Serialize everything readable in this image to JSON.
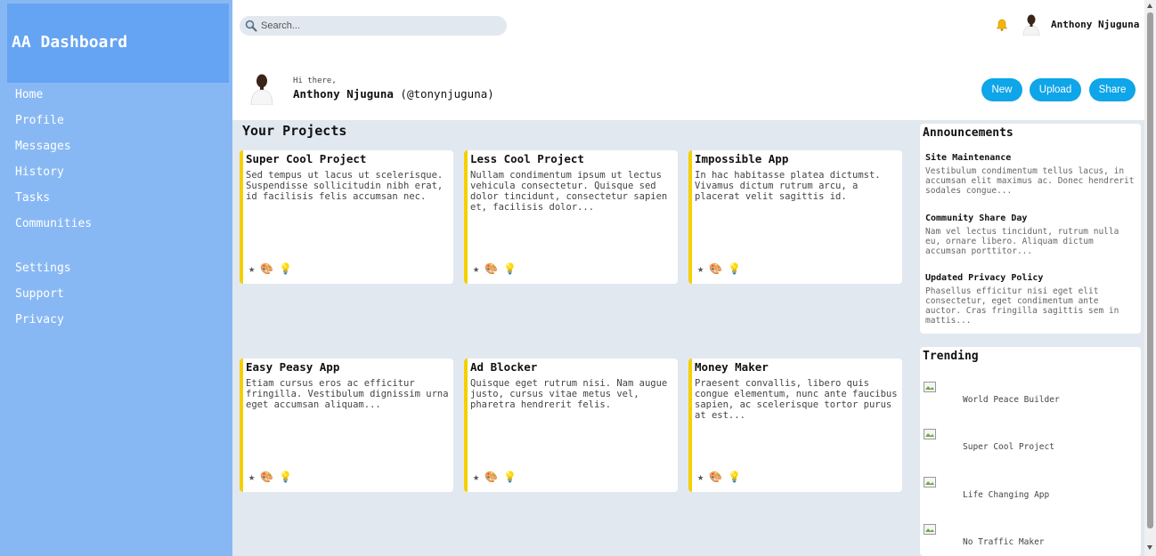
{
  "brand": "AA Dashboard",
  "sidebar": {
    "primary": [
      {
        "label": "Home"
      },
      {
        "label": "Profile"
      },
      {
        "label": "Messages"
      },
      {
        "label": "History"
      },
      {
        "label": "Tasks"
      },
      {
        "label": "Communities"
      }
    ],
    "secondary": [
      {
        "label": "Settings"
      },
      {
        "label": "Support"
      },
      {
        "label": "Privacy"
      }
    ]
  },
  "search": {
    "placeholder": "Search...",
    "icon": "search-icon"
  },
  "header": {
    "user_name": "Anthony Njuguna",
    "greeting": "Hi there,",
    "full_name": "Anthony Njuguna",
    "handle": "(@tonynjuguna)",
    "buttons": {
      "new": "New",
      "upload": "Upload",
      "share": "Share"
    }
  },
  "projects": {
    "title": "Your Projects",
    "items": [
      {
        "title": "Super Cool Project",
        "text": "Sed tempus ut lacus ut scelerisque. Suspendisse sollicitudin nibh erat, id facilisis felis accumsan nec."
      },
      {
        "title": "Less Cool Project",
        "text": "Nullam condimentum ipsum ut lectus vehicula consectetur. Quisque sed dolor tincidunt, consectetur sapien et, facilisis dolor..."
      },
      {
        "title": "Impossible App",
        "text": "In hac habitasse platea dictumst. Vivamus dictum rutrum arcu, a placerat velit sagittis id."
      },
      {
        "title": "Easy Peasy App",
        "text": "Etiam cursus eros ac efficitur fringilla. Vestibulum dignissim urna eget accumsan aliquam..."
      },
      {
        "title": "Ad Blocker",
        "text": "Quisque eget rutrum nisi. Nam augue justo, cursus vitae metus vel, pharetra hendrerit felis."
      },
      {
        "title": "Money Maker",
        "text": "Praesent convallis, libero quis congue elementum, nunc ante faucibus sapien, ac scelerisque tortor purus at est..."
      }
    ],
    "card_icons": {
      "star": "★",
      "palette": "🎨",
      "bulb": "💡"
    }
  },
  "announcements": {
    "title": "Announcements",
    "items": [
      {
        "title": "Site Maintenance",
        "text": "Vestibulum condimentum tellus lacus, in accumsan elit maximus ac. Donec hendrerit sodales congue..."
      },
      {
        "title": "Community Share Day",
        "text": "Nam vel lectus tincidunt, rutrum nulla eu, ornare libero. Aliquam dictum accumsan porttitor..."
      },
      {
        "title": "Updated Privacy Policy",
        "text": "Phasellus efficitur nisi eget elit consectetur, eget condimentum ante auctor. Cras fringilla sagittis sem in mattis..."
      }
    ]
  },
  "trending": {
    "title": "Trending",
    "items": [
      {
        "label": "World Peace Builder"
      },
      {
        "label": "Super Cool Project"
      },
      {
        "label": "Life Changing App"
      },
      {
        "label": "No Traffic Maker"
      }
    ]
  },
  "colors": {
    "sidebar_bg": "#88b8f4",
    "brand_bg": "#64a4f2",
    "main_bg": "#e2e8f0",
    "button": "#0ea5e9",
    "card_accent": "#f5d000"
  }
}
